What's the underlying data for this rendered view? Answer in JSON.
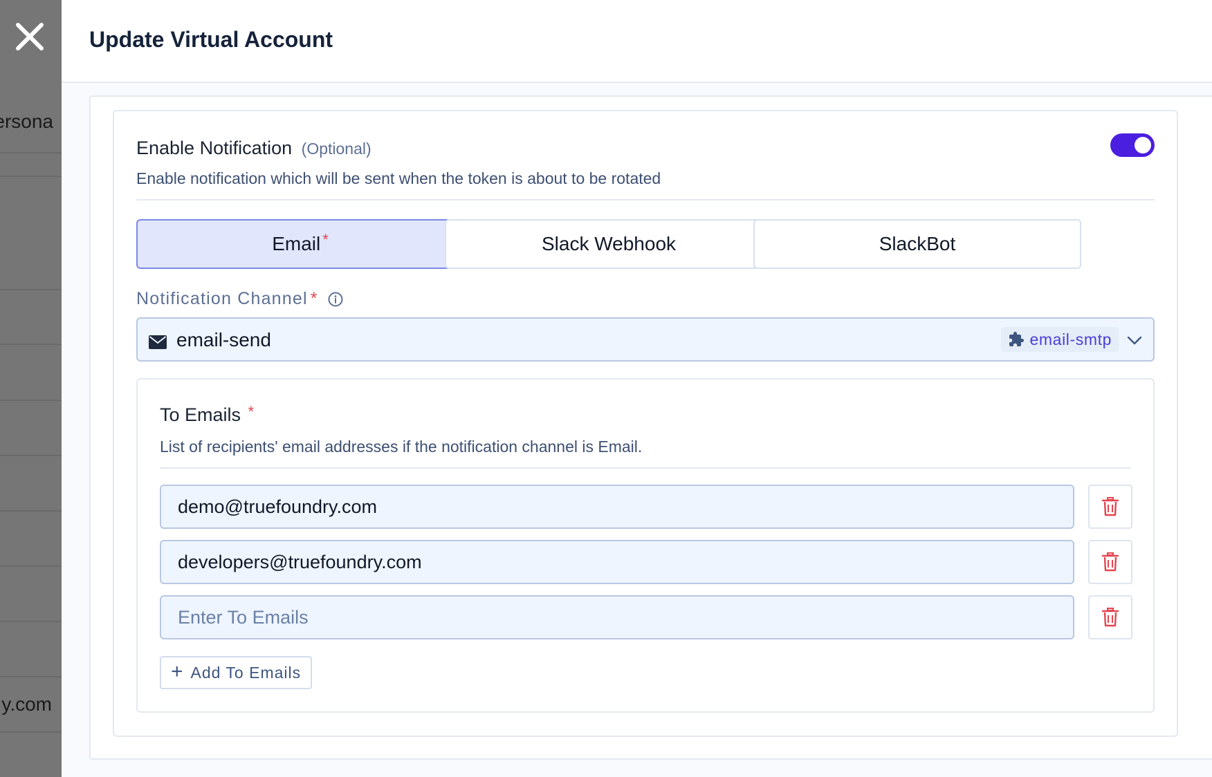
{
  "backdrop": {
    "partial_text_top": "ersona",
    "partial_text_bottom": "y.com"
  },
  "drawer": {
    "title": "Update Virtual Account"
  },
  "notification": {
    "title": "Enable Notification",
    "optional_tag": "(Optional)",
    "description": "Enable notification which will be sent when the token is about to be rotated",
    "enabled": true,
    "tabs": [
      {
        "label": "Email",
        "required": "*",
        "active": true
      },
      {
        "label": "Slack Webhook",
        "active": false
      },
      {
        "label": "SlackBot",
        "active": false
      }
    ],
    "channel_label": "Notification Channel",
    "channel_required": "*",
    "channel_value": "email-send",
    "channel_integration": "email-smtp"
  },
  "to_emails": {
    "title": "To Emails",
    "required": "*",
    "description": "List of recipients' email addresses if the notification channel is Email.",
    "entries": [
      "demo@truefoundry.com",
      "developers@truefoundry.com",
      ""
    ],
    "placeholder": "Enter To Emails",
    "add_label": "Add To Emails"
  },
  "colors": {
    "accent": "#4b1fe0",
    "active_tab_bg": "#e1e6fd",
    "delete_red": "#e4444e",
    "required_red": "#e4444e"
  },
  "icons": [
    "close-icon",
    "info-icon",
    "mail-icon",
    "puzzle-icon",
    "chevron-down-icon",
    "trash-icon",
    "plus-icon"
  ]
}
